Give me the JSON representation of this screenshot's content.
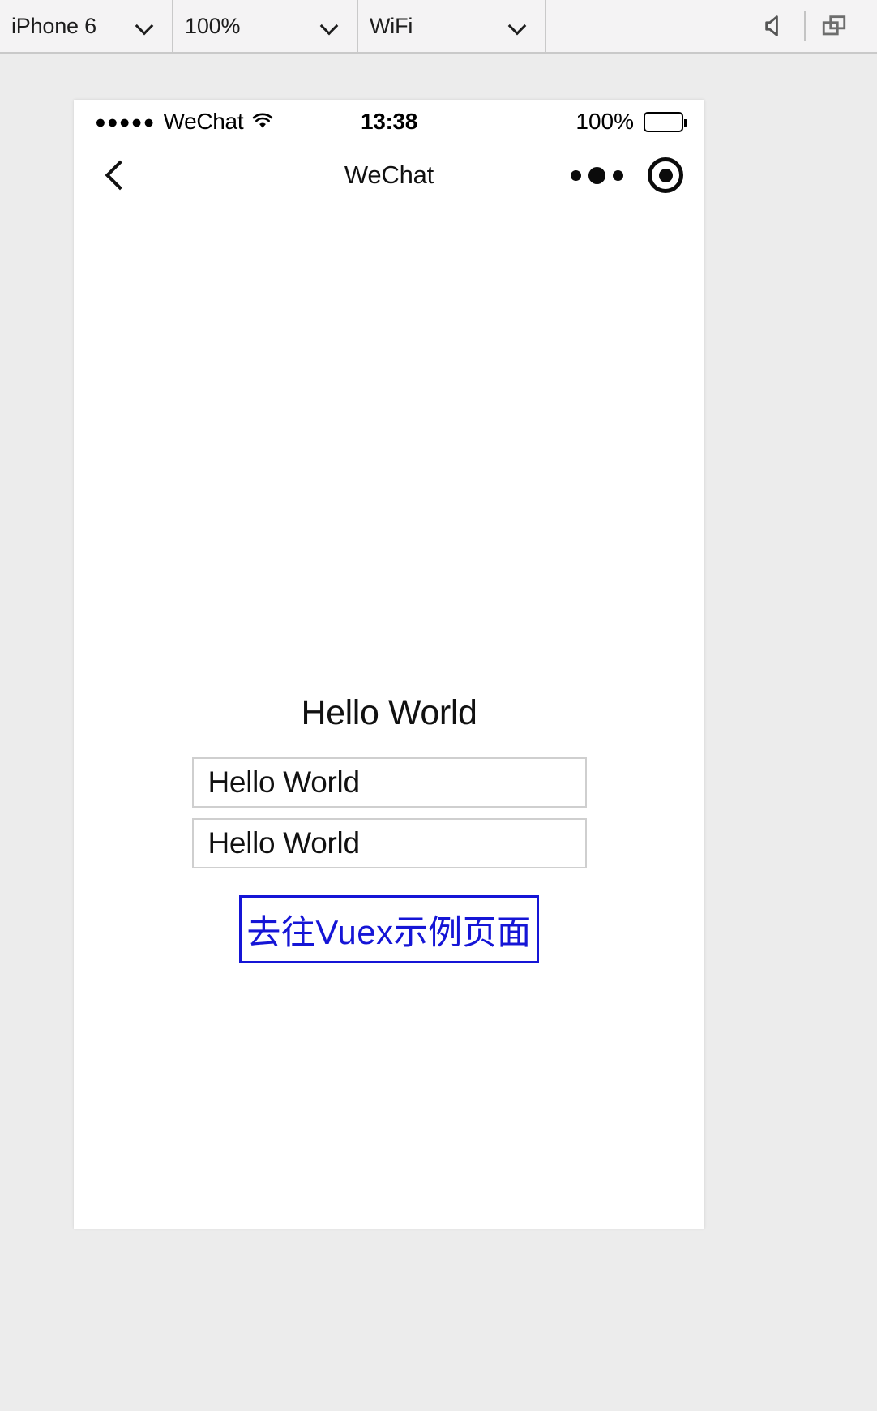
{
  "simulator": {
    "device_select": {
      "value": "iPhone 6",
      "icon": "chevron-down-icon"
    },
    "zoom_select": {
      "value": "100%",
      "icon": "chevron-down-icon"
    },
    "network_select": {
      "value": "WiFi",
      "icon": "chevron-down-icon"
    },
    "tools": {
      "sound_icon": "speaker-icon",
      "window_icon": "multi-window-icon"
    }
  },
  "phone": {
    "status_bar": {
      "signal_dots": "●●●●●",
      "carrier": "WeChat",
      "wifi_icon": "wifi-icon",
      "time": "13:38",
      "battery_percent": "100%",
      "battery_level": 100
    },
    "nav_bar": {
      "back_icon": "chevron-left-icon",
      "title": "WeChat",
      "menu_icon": "more-dots-icon",
      "close_icon": "target-circle-icon"
    },
    "content": {
      "heading": "Hello World",
      "input_one": {
        "value": "Hello World",
        "placeholder": ""
      },
      "input_two": {
        "value": "Hello World",
        "placeholder": ""
      },
      "button_label": "去往Vuex示例页面"
    }
  },
  "colors": {
    "accent_blue": "#1515d6",
    "toolbar_bg": "#f4f3f4",
    "page_bg": "#ececec",
    "phone_bg": "#ffffff",
    "input_border": "#cfcfcf"
  }
}
